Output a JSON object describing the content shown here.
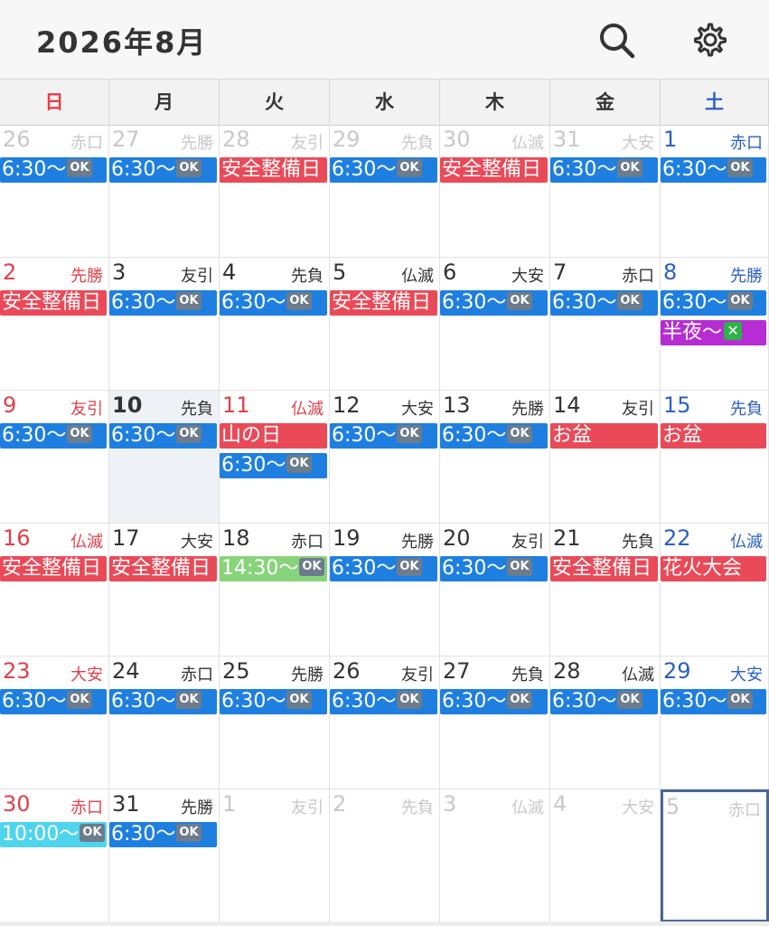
{
  "header": {
    "title": "2026年8月",
    "search_icon": "search-icon",
    "settings_icon": "gear-icon"
  },
  "weekdays": [
    "日",
    "月",
    "火",
    "水",
    "木",
    "金",
    "土"
  ],
  "colors": {
    "sunday": "#e0404a",
    "saturday": "#2a5fc7",
    "event_blue": "#1f7fe0",
    "event_red": "#ea4a58",
    "event_purple": "#b62dd3",
    "event_green": "#88d47a",
    "event_cyan": "#4fd4ee",
    "today_bg": "#eef2f6",
    "selected_border": "#4a6a95"
  },
  "weeks": [
    [
      {
        "day": "26",
        "rokuyo": "赤口",
        "other_month": true,
        "events": [
          {
            "text": "6:30〜",
            "badge": "OK",
            "color": "blue"
          }
        ]
      },
      {
        "day": "27",
        "rokuyo": "先勝",
        "other_month": true,
        "events": [
          {
            "text": "6:30〜",
            "badge": "OK",
            "color": "blue"
          }
        ]
      },
      {
        "day": "28",
        "rokuyo": "友引",
        "other_month": true,
        "events": [
          {
            "text": "安全整備日",
            "color": "red"
          }
        ]
      },
      {
        "day": "29",
        "rokuyo": "先負",
        "other_month": true,
        "events": [
          {
            "text": "6:30〜",
            "badge": "OK",
            "color": "blue"
          }
        ]
      },
      {
        "day": "30",
        "rokuyo": "仏滅",
        "other_month": true,
        "events": [
          {
            "text": "安全整備日",
            "color": "red"
          }
        ]
      },
      {
        "day": "31",
        "rokuyo": "大安",
        "other_month": true,
        "events": [
          {
            "text": "6:30〜",
            "badge": "OK",
            "color": "blue"
          }
        ]
      },
      {
        "day": "1",
        "rokuyo": "赤口",
        "events": [
          {
            "text": "6:30〜",
            "badge": "OK",
            "color": "blue"
          }
        ]
      }
    ],
    [
      {
        "day": "2",
        "rokuyo": "先勝",
        "events": [
          {
            "text": "安全整備日",
            "color": "red"
          }
        ]
      },
      {
        "day": "3",
        "rokuyo": "友引",
        "events": [
          {
            "text": "6:30〜",
            "badge": "OK",
            "color": "blue"
          }
        ]
      },
      {
        "day": "4",
        "rokuyo": "先負",
        "events": [
          {
            "text": "6:30〜",
            "badge": "OK",
            "color": "blue"
          }
        ]
      },
      {
        "day": "5",
        "rokuyo": "仏滅",
        "events": [
          {
            "text": "安全整備日",
            "color": "red"
          }
        ]
      },
      {
        "day": "6",
        "rokuyo": "大安",
        "events": [
          {
            "text": "6:30〜",
            "badge": "OK",
            "color": "blue"
          }
        ]
      },
      {
        "day": "7",
        "rokuyo": "赤口",
        "events": [
          {
            "text": "6:30〜",
            "badge": "OK",
            "color": "blue"
          }
        ]
      },
      {
        "day": "8",
        "rokuyo": "先勝",
        "events": [
          {
            "text": "6:30〜",
            "badge": "OK",
            "color": "blue"
          },
          {
            "text": "半夜〜",
            "badge": "✕",
            "color": "purple"
          }
        ]
      }
    ],
    [
      {
        "day": "9",
        "rokuyo": "友引",
        "events": [
          {
            "text": "6:30〜",
            "badge": "OK",
            "color": "blue"
          }
        ]
      },
      {
        "day": "10",
        "rokuyo": "先負",
        "today": true,
        "events": [
          {
            "text": "6:30〜",
            "badge": "OK",
            "color": "blue"
          }
        ]
      },
      {
        "day": "11",
        "rokuyo": "仏滅",
        "holiday": true,
        "events": [
          {
            "text": "山の日",
            "color": "red"
          },
          {
            "text": "6:30〜",
            "badge": "OK",
            "color": "blue"
          }
        ]
      },
      {
        "day": "12",
        "rokuyo": "大安",
        "events": [
          {
            "text": "6:30〜",
            "badge": "OK",
            "color": "blue"
          }
        ]
      },
      {
        "day": "13",
        "rokuyo": "先勝",
        "events": [
          {
            "text": "6:30〜",
            "badge": "OK",
            "color": "blue"
          }
        ]
      },
      {
        "day": "14",
        "rokuyo": "友引",
        "events": [
          {
            "text": "お盆",
            "color": "red"
          }
        ]
      },
      {
        "day": "15",
        "rokuyo": "先負",
        "events": [
          {
            "text": "お盆",
            "color": "red"
          }
        ]
      }
    ],
    [
      {
        "day": "16",
        "rokuyo": "仏滅",
        "events": [
          {
            "text": "安全整備日",
            "color": "red"
          }
        ]
      },
      {
        "day": "17",
        "rokuyo": "大安",
        "events": [
          {
            "text": "安全整備日",
            "color": "red"
          }
        ]
      },
      {
        "day": "18",
        "rokuyo": "赤口",
        "events": [
          {
            "text": "14:30〜",
            "badge": "OK",
            "color": "green"
          }
        ]
      },
      {
        "day": "19",
        "rokuyo": "先勝",
        "events": [
          {
            "text": "6:30〜",
            "badge": "OK",
            "color": "blue"
          }
        ]
      },
      {
        "day": "20",
        "rokuyo": "友引",
        "events": [
          {
            "text": "6:30〜",
            "badge": "OK",
            "color": "blue"
          }
        ]
      },
      {
        "day": "21",
        "rokuyo": "先負",
        "events": [
          {
            "text": "安全整備日",
            "color": "red"
          }
        ]
      },
      {
        "day": "22",
        "rokuyo": "仏滅",
        "events": [
          {
            "text": "花火大会",
            "color": "red"
          }
        ]
      }
    ],
    [
      {
        "day": "23",
        "rokuyo": "大安",
        "events": [
          {
            "text": "6:30〜",
            "badge": "OK",
            "color": "blue"
          }
        ]
      },
      {
        "day": "24",
        "rokuyo": "赤口",
        "events": [
          {
            "text": "6:30〜",
            "badge": "OK",
            "color": "blue"
          }
        ]
      },
      {
        "day": "25",
        "rokuyo": "先勝",
        "events": [
          {
            "text": "6:30〜",
            "badge": "OK",
            "color": "blue"
          }
        ]
      },
      {
        "day": "26",
        "rokuyo": "友引",
        "events": [
          {
            "text": "6:30〜",
            "badge": "OK",
            "color": "blue"
          }
        ]
      },
      {
        "day": "27",
        "rokuyo": "先負",
        "events": [
          {
            "text": "6:30〜",
            "badge": "OK",
            "color": "blue"
          }
        ]
      },
      {
        "day": "28",
        "rokuyo": "仏滅",
        "events": [
          {
            "text": "6:30〜",
            "badge": "OK",
            "color": "blue"
          }
        ]
      },
      {
        "day": "29",
        "rokuyo": "大安",
        "events": [
          {
            "text": "6:30〜",
            "badge": "OK",
            "color": "blue"
          }
        ]
      }
    ],
    [
      {
        "day": "30",
        "rokuyo": "赤口",
        "events": [
          {
            "text": "10:00〜",
            "badge": "OK",
            "color": "cyan"
          }
        ]
      },
      {
        "day": "31",
        "rokuyo": "先勝",
        "events": [
          {
            "text": "6:30〜",
            "badge": "OK",
            "color": "blue"
          }
        ]
      },
      {
        "day": "1",
        "rokuyo": "友引",
        "other_month": true,
        "events": []
      },
      {
        "day": "2",
        "rokuyo": "先負",
        "other_month": true,
        "events": []
      },
      {
        "day": "3",
        "rokuyo": "仏滅",
        "other_month": true,
        "events": []
      },
      {
        "day": "4",
        "rokuyo": "大安",
        "other_month": true,
        "events": []
      },
      {
        "day": "5",
        "rokuyo": "赤口",
        "other_month": true,
        "selected": true,
        "events": []
      }
    ]
  ]
}
